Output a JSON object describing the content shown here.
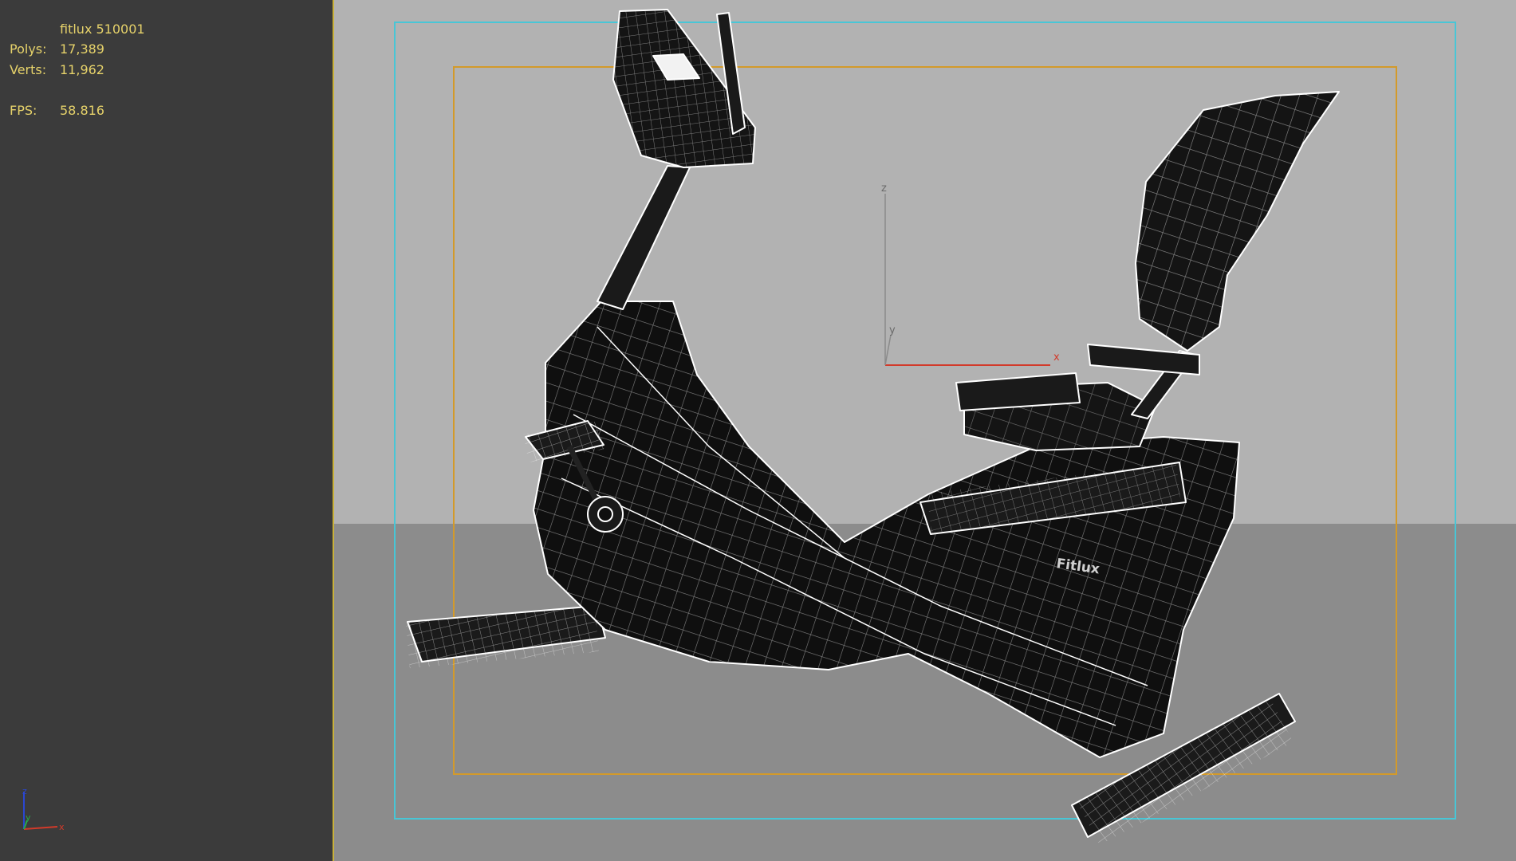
{
  "hud": {
    "object_name": "fitlux 510001",
    "polys_label": "Polys:",
    "polys_value": "17,389",
    "verts_label": "Verts:",
    "verts_value": "11,962",
    "fps_label": "FPS:",
    "fps_value": "58.816"
  },
  "gizmo": {
    "x": "x",
    "y": "y",
    "z": "z"
  },
  "view_axis": {
    "x": "x",
    "y": "y",
    "z": "z"
  },
  "model_badge": "Fitlux",
  "colors": {
    "hud_text": "#e6d26a",
    "safe_frame_outer": "#48c6d6",
    "safe_frame_inner": "#d39a2a",
    "axis_x": "#d23a2a",
    "axis_y": "#2aa84a",
    "axis_z": "#2a46d2"
  }
}
